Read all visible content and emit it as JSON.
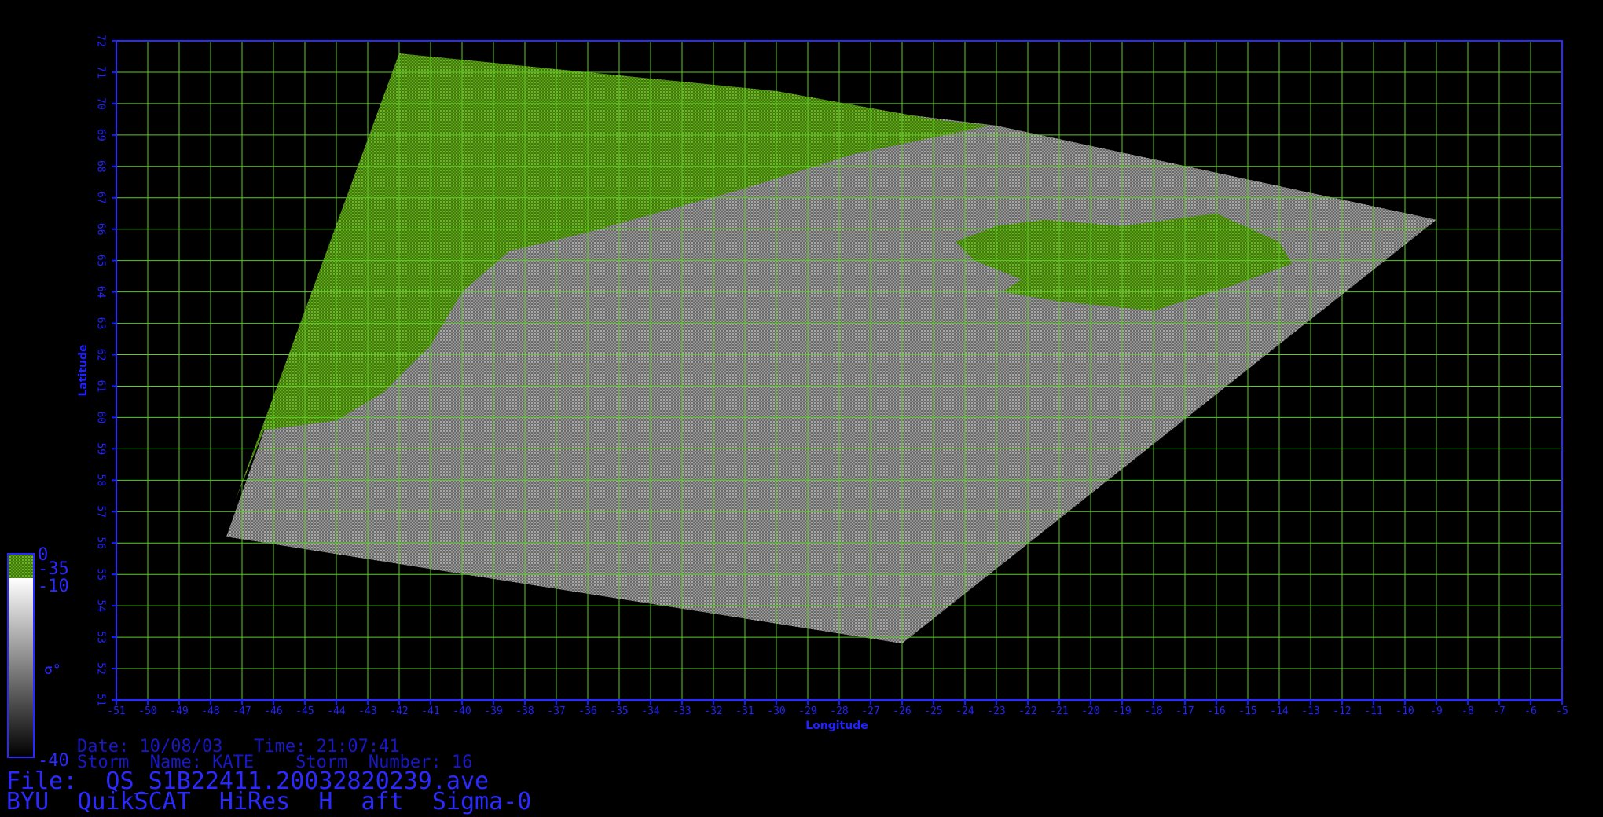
{
  "map": {
    "lon_min": -51,
    "lon_max": -5,
    "lat_min": 51,
    "lat_max": 72,
    "xlabel": "Longitude",
    "ylabel": "Latitude",
    "x_ticks": [
      -51,
      -50,
      -49,
      -48,
      -47,
      -46,
      -45,
      -44,
      -43,
      -42,
      -41,
      -40,
      -39,
      -38,
      -37,
      -36,
      -35,
      -34,
      -33,
      -32,
      -31,
      -30,
      -29,
      -28,
      -27,
      -26,
      -25,
      -24,
      -23,
      -22,
      -21,
      -20,
      -19,
      -18,
      -17,
      -16,
      -15,
      -14,
      -13,
      -12,
      -11,
      -10,
      -9,
      -8,
      -7,
      -6,
      -5
    ],
    "y_ticks": [
      51,
      52,
      53,
      54,
      55,
      56,
      57,
      58,
      59,
      60,
      61,
      62,
      63,
      64,
      65,
      66,
      67,
      68,
      69,
      70,
      71,
      72
    ],
    "grid": true,
    "colors": {
      "grid": "#5ecc22",
      "axis": "#1a1aff",
      "land": "#4d8a10",
      "ocean": "#7a7a7a",
      "background": "#000000"
    },
    "swath_corners": [
      [
        -47.5,
        56.2
      ],
      [
        -42,
        71.6
      ],
      [
        -23,
        69.3
      ],
      [
        -9,
        66.3
      ],
      [
        -26,
        52.8
      ]
    ],
    "greenland_coast": [
      [
        -42,
        71.6
      ],
      [
        -36,
        69.8
      ],
      [
        -32,
        68.8
      ],
      [
        -29,
        68.6
      ],
      [
        -25,
        69.0
      ],
      [
        -23.2,
        69.3
      ]
    ],
    "iceland": [
      [
        -24.3,
        65.6
      ],
      [
        -23,
        66.1
      ],
      [
        -21.5,
        66.3
      ],
      [
        -19,
        66.1
      ],
      [
        -16,
        66.5
      ],
      [
        -14,
        65.6
      ],
      [
        -13.6,
        64.9
      ],
      [
        -15.5,
        64.2
      ],
      [
        -18,
        63.4
      ],
      [
        -21,
        63.7
      ],
      [
        -22.8,
        64.0
      ],
      [
        -22.2,
        64.4
      ],
      [
        -23.7,
        65.0
      ]
    ]
  },
  "colorbar": {
    "label_0": "0",
    "label_35": "-35",
    "label_10": "-10",
    "label_40": "-40",
    "symbol": "σ°"
  },
  "info": {
    "date_line": "Date: 10/08/03   Time: 21:07:41",
    "storm_line": "Storm  Name: KATE    Storm  Number: 16",
    "file_line": "File:  QS_S1B22411.20032820239.ave",
    "product_line": "BYU  QuikSCAT  HiRes  H  aft  Sigma-0"
  }
}
